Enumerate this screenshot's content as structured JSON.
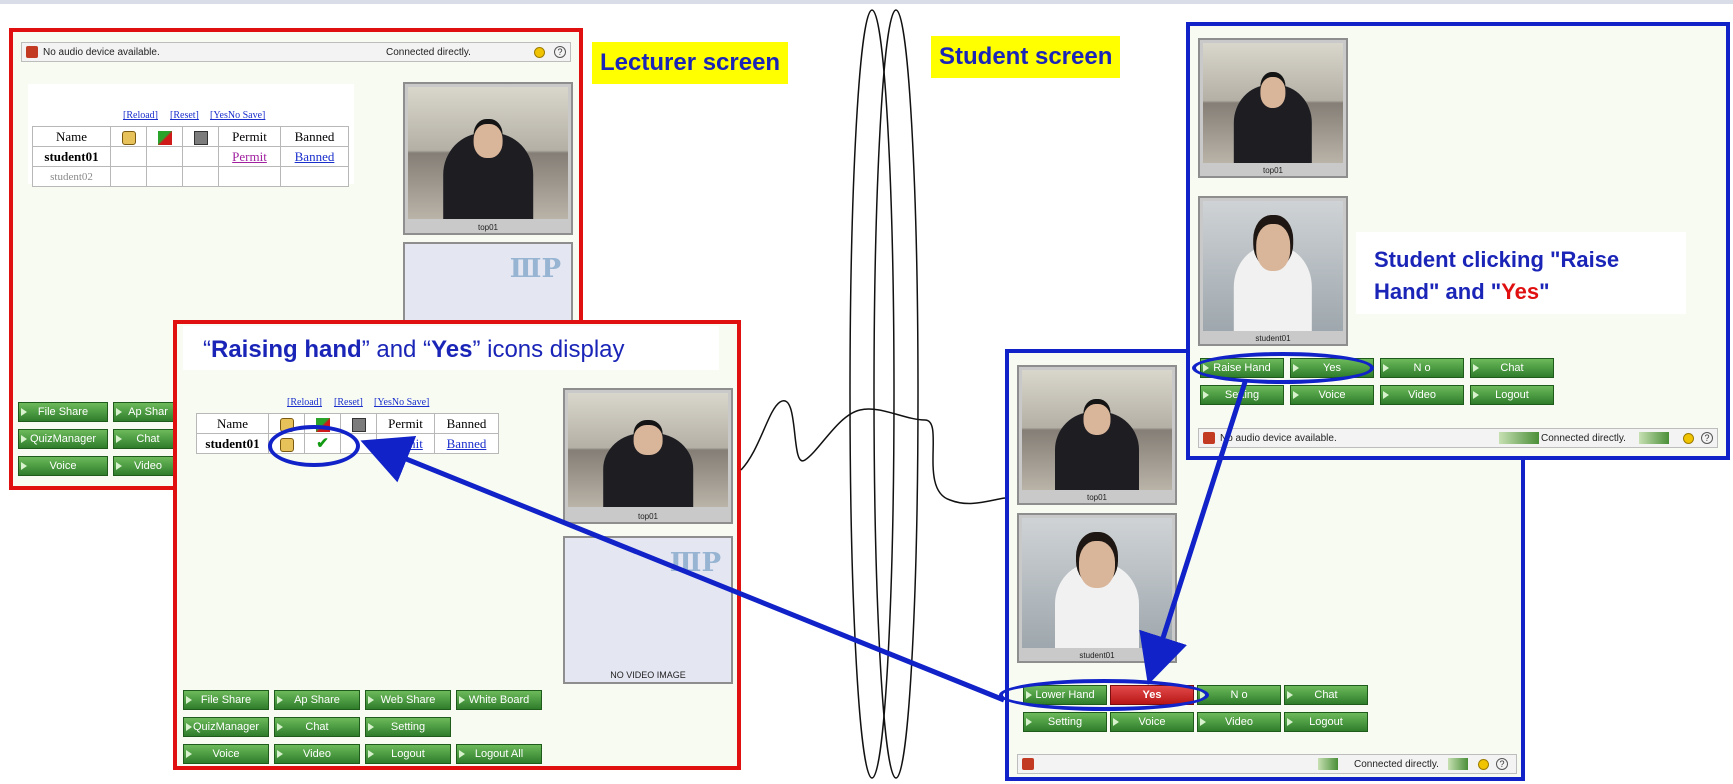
{
  "labels": {
    "lecturer_screen": "Lecturer screen",
    "student_screen": "Student screen",
    "raising_open": "“",
    "raising_bold": "Raising hand",
    "raising_mid": "” and “",
    "raising_yes": "Yes",
    "raising_end": "” icons display",
    "student_click_line1": "Student clicking \"Raise",
    "student_click_line2a": "Hand\" and \"",
    "student_click_yes": "Yes",
    "student_click_line2b": "\""
  },
  "lecturer": {
    "status": {
      "audio": "No audio device available.",
      "connection": "Connected directly.",
      "help": "?"
    },
    "controls": {
      "reload": "[Reload]",
      "reset": "[Reset]",
      "yesno_save": "[YesNo Save]"
    },
    "table": {
      "headers": {
        "name": "Name",
        "permit": "Permit",
        "banned": "Banned"
      },
      "rows": [
        {
          "name": "student01",
          "permit": "Permit",
          "banned": "Banned"
        },
        {
          "name": "student02"
        }
      ]
    },
    "video": {
      "label": "top01"
    },
    "buttons": {
      "file_share": "File Share",
      "ap_share": "Ap Shar",
      "quiz_manager": "QuizManager",
      "chat": "Chat",
      "voice": "Voice",
      "video": "Video"
    }
  },
  "zoom": {
    "controls": {
      "reload": "[Reload]",
      "reset": "[Reset]",
      "yesno_save": "[YesNo Save]"
    },
    "table": {
      "headers": {
        "name": "Name",
        "permit": "Permit",
        "banned": "Banned"
      },
      "rows": [
        {
          "name": "student01",
          "permit": "Permit",
          "banned": "Banned"
        }
      ]
    },
    "video": {
      "label": "top01",
      "no_video": "NO VIDEO IMAGE"
    },
    "buttons": {
      "file_share": "File Share",
      "ap_share": "Ap Share",
      "web_share": "Web Share",
      "white_board": "White Board",
      "quiz_manager": "QuizManager",
      "chat": "Chat",
      "setting": "Setting",
      "voice": "Voice",
      "video": "Video",
      "logout": "Logout",
      "logout_all": "Logout All"
    }
  },
  "student_top": {
    "videos": {
      "top": "top01",
      "student": "student01"
    },
    "buttons": {
      "raise_hand": "Raise Hand",
      "yes": "Yes",
      "no": "N o",
      "chat": "Chat",
      "setting": "Setting",
      "voice": "Voice",
      "video": "Video",
      "logout": "Logout"
    },
    "status": {
      "audio": "No audio device available.",
      "connection": "Connected directly.",
      "help": "?"
    }
  },
  "student_bottom": {
    "videos": {
      "top": "top01",
      "student": "student01"
    },
    "buttons": {
      "lower_hand": "Lower Hand",
      "yes": "Yes",
      "no": "N o",
      "chat": "Chat",
      "setting": "Setting",
      "voice": "Voice",
      "video": "Video",
      "logout": "Logout"
    },
    "status": {
      "connection": "Connected directly.",
      "help": "?"
    }
  },
  "colors": {
    "lecturer_frame": "#e01010",
    "student_frame": "#1022c8",
    "callout_bg": "#ffff00",
    "callout_text": "#1a25b8",
    "button_green": "#3f8f35",
    "yes_red": "#c81e1e"
  }
}
